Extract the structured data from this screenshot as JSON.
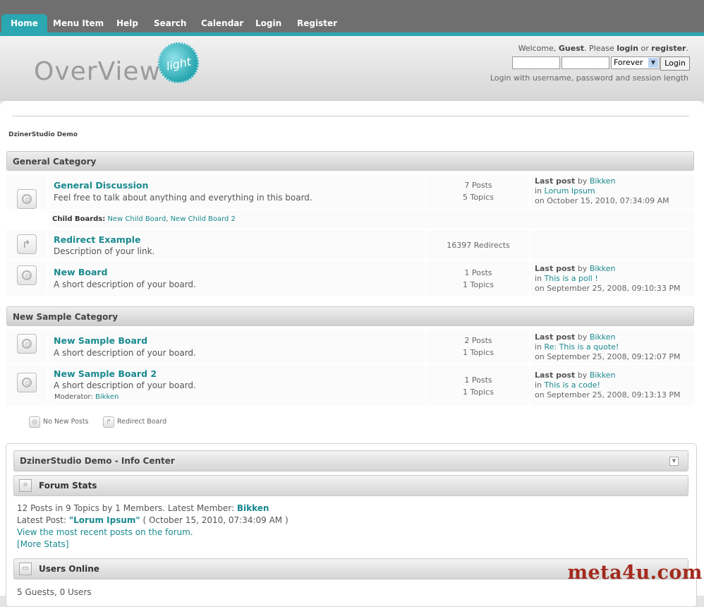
{
  "nav": {
    "items": [
      "Home",
      "Menu Item",
      "Help",
      "Search",
      "Calendar",
      "Login",
      "Register"
    ]
  },
  "header": {
    "logo_text": "OverView",
    "logo_badge": "light",
    "welcome_prefix": "Welcome, ",
    "welcome_user": "Guest",
    "welcome_mid": ". Please ",
    "welcome_login": "login",
    "welcome_or": " or ",
    "welcome_register": "register",
    "welcome_end": ".",
    "session_select": "Forever",
    "login_button": "Login",
    "login_hint": "Login with username, password and session length"
  },
  "breadcrumb": "DzinerStudio Demo",
  "categories": [
    {
      "name": "General Category",
      "boards": [
        {
          "title": "General Discussion",
          "desc": "Feel free to talk about anything and everything in this board.",
          "stats": [
            "7 Posts",
            "5 Topics"
          ],
          "last_label": "Last post",
          "by": "by",
          "user": "Bikken",
          "in": "in",
          "topic": "Lorum Ipsum",
          "date": "on October 15, 2010, 07:34:09 AM"
        },
        {
          "title": "Redirect Example",
          "desc": "Description of your link.",
          "stats": [
            "16397 Redirects"
          ]
        },
        {
          "title": "New Board",
          "desc": "A short description of your board.",
          "stats": [
            "1 Posts",
            "1 Topics"
          ],
          "last_label": "Last post",
          "by": "by",
          "user": "Bikken",
          "in": "in",
          "topic": "This is a poll !",
          "date": "on September 25, 2008, 09:10:33 PM"
        }
      ],
      "child_label": "Child Boards:",
      "child_boards": [
        "New Child Board",
        "New Child Board 2"
      ]
    },
    {
      "name": "New Sample Category",
      "boards": [
        {
          "title": "New Sample Board",
          "desc": "A short description of your board.",
          "stats": [
            "2 Posts",
            "1 Topics"
          ],
          "last_label": "Last post",
          "by": "by",
          "user": "Bikken",
          "in": "in",
          "topic": "Re: This is a quote!",
          "date": "on September 25, 2008, 09:12:07 PM"
        },
        {
          "title": "New Sample Board 2",
          "desc": "A short description of your board.",
          "moderator_label": "Moderator:",
          "moderator": "Bikken",
          "stats": [
            "1 Posts",
            "1 Topics"
          ],
          "last_label": "Last post",
          "by": "by",
          "user": "Bikken",
          "in": "in",
          "topic": "This is a code!",
          "date": "on September 25, 2008, 09:13:13 PM"
        }
      ]
    }
  ],
  "legend": {
    "no_new": "No New Posts",
    "redirect": "Redirect Board"
  },
  "info_center": {
    "title": "DzinerStudio Demo - Info Center",
    "forum_stats_title": "Forum Stats",
    "stats_line1": "12 Posts in 9 Topics by 1 Members. Latest Member: ",
    "latest_member": "Bikken",
    "latest_post_label": "Latest Post: ",
    "latest_post": "\"Lorum Ipsum\"",
    "latest_post_date": " ( October 15, 2010, 07:34:09 AM )",
    "recent_link": "View the most recent posts on the forum.",
    "more_stats": "[More Stats]",
    "users_online_title": "Users Online",
    "users_online_line": "5 Guests, 0 Users"
  },
  "watermark": "meta4u.com"
}
